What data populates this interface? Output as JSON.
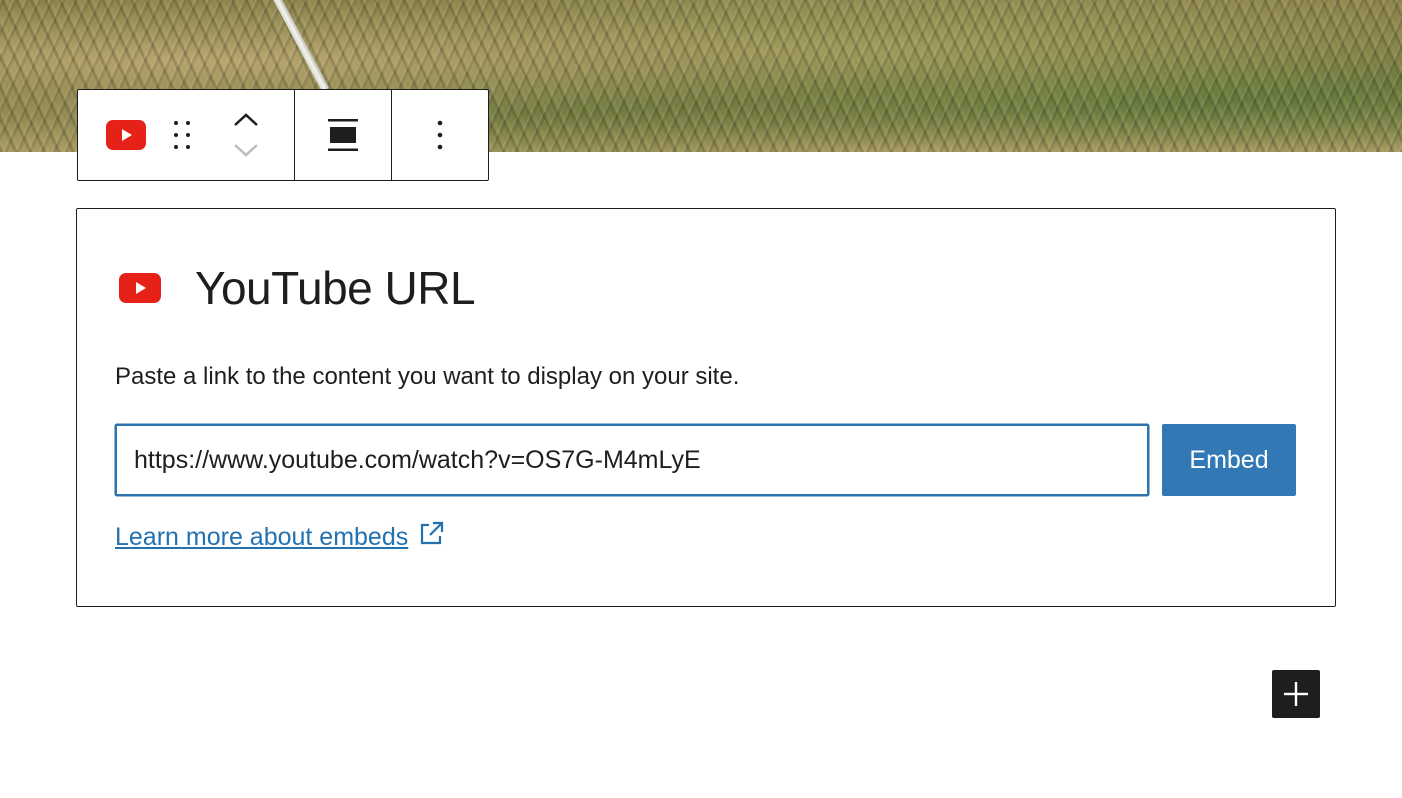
{
  "colors": {
    "youtube_red": "#e62117",
    "accent_blue": "#2271b1",
    "border_dark": "#1e1e1e"
  },
  "toolbar": {
    "block_icon": "youtube-icon",
    "drag_icon": "drag-handle-icon",
    "move_up_icon": "chevron-up-icon",
    "move_down_icon": "chevron-down-icon",
    "align_icon": "align-wide-icon",
    "options_icon": "more-vertical-icon"
  },
  "placeholder": {
    "title": "YouTube URL",
    "instructions": "Paste a link to the content you want to display on your site.",
    "url_value": "https://www.youtube.com/watch?v=OS7G-M4mLyE",
    "embed_label": "Embed",
    "learn_more_label": "Learn more about embeds"
  },
  "inserter": {
    "icon": "plus-icon"
  }
}
